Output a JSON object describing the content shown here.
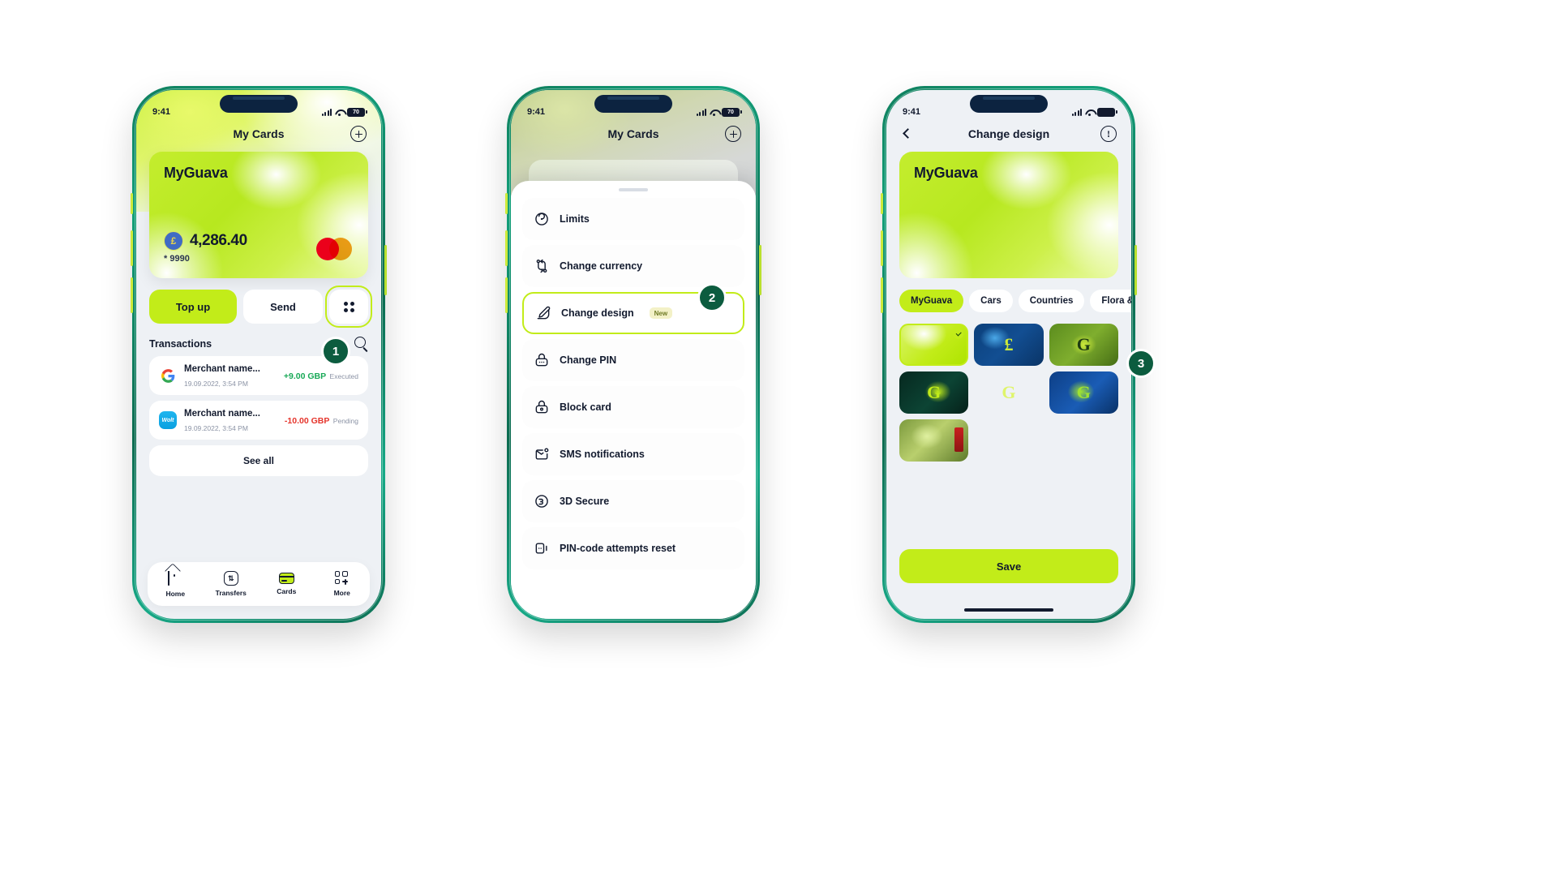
{
  "status_bar": {
    "time": "9:41",
    "battery": "70",
    "battery_full": ""
  },
  "steps": {
    "one": "1",
    "two": "2",
    "three": "3"
  },
  "screen1": {
    "nav_title": "My Cards",
    "add_icon": "circle-plus-icon",
    "card": {
      "brand": "MyGuava",
      "currency_symbol": "£",
      "amount": "4,286.40",
      "masked_number": "* 9990",
      "network": "mastercard-logo"
    },
    "actions": {
      "top_up": "Top up",
      "send": "Send",
      "more": "more-options-icon"
    },
    "transactions": {
      "title": "Transactions",
      "search_icon": "search-icon",
      "see_all": "See all",
      "items": [
        {
          "icon": "google-icon",
          "name": "Merchant name...",
          "date": "19.09.2022, 3:54 PM",
          "amount": "+9.00 GBP",
          "status": "Executed",
          "sign": "pos"
        },
        {
          "icon": "wolt-icon",
          "name": "Merchant name...",
          "date": "19.09.2022, 3:54 PM",
          "amount": "-10.00 GBP",
          "status": "Pending",
          "sign": "neg"
        }
      ]
    },
    "tabs": [
      {
        "label": "Home",
        "icon": "home-icon"
      },
      {
        "label": "Transfers",
        "icon": "transfers-icon"
      },
      {
        "label": "Cards",
        "icon": "cards-icon"
      },
      {
        "label": "More",
        "icon": "more-grid-icon"
      }
    ]
  },
  "screen2": {
    "nav_title": "My Cards",
    "menu": [
      {
        "label": "Limits",
        "icon": "limits-icon",
        "badge": ""
      },
      {
        "label": "Change currency",
        "icon": "change-currency-icon",
        "badge": ""
      },
      {
        "label": "Change design",
        "icon": "change-design-icon",
        "badge": "New"
      },
      {
        "label": "Change PIN",
        "icon": "change-pin-icon",
        "badge": ""
      },
      {
        "label": "Block card",
        "icon": "block-card-icon",
        "badge": ""
      },
      {
        "label": "SMS notifications",
        "icon": "sms-notifications-icon",
        "badge": ""
      },
      {
        "label": "3D Secure",
        "icon": "3d-secure-icon",
        "badge": ""
      },
      {
        "label": "PIN-code attempts reset",
        "icon": "pin-reset-icon",
        "badge": ""
      }
    ]
  },
  "screen3": {
    "nav_title": "Change design",
    "back_icon": "chevron-left-icon",
    "info_icon": "info-icon",
    "card": {
      "brand": "MyGuava"
    },
    "chips": [
      "MyGuava",
      "Cars",
      "Countries",
      "Flora &"
    ],
    "active_chip": "MyGuava",
    "designs": [
      {
        "name": "myguava-green",
        "selected": true,
        "glyph": ""
      },
      {
        "name": "blue-coins",
        "selected": false,
        "glyph": "£"
      },
      {
        "name": "green-quilt",
        "selected": false,
        "glyph": "G"
      },
      {
        "name": "dark-swirl",
        "selected": false,
        "glyph": "G"
      },
      {
        "name": "dark-burst",
        "selected": false,
        "glyph": "G"
      },
      {
        "name": "blue-splash",
        "selected": false,
        "glyph": "G"
      },
      {
        "name": "cash-stack",
        "selected": false,
        "glyph": ""
      }
    ],
    "save_label": "Save"
  },
  "colors": {
    "accent": "#c2ec19",
    "frame": "#0c6b50",
    "dark": "#121a2e",
    "positive": "#18a957",
    "negative": "#e5342b"
  }
}
